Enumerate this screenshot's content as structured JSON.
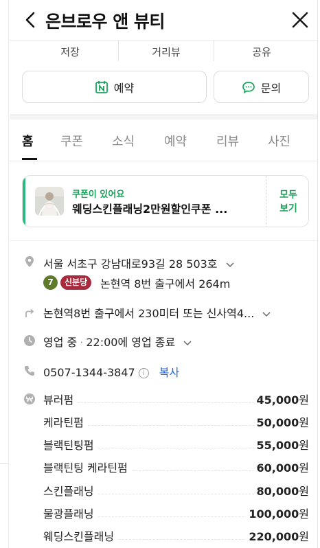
{
  "header": {
    "title": "은브로우 앤 뷰티"
  },
  "top_actions": [
    "저장",
    "거리뷰",
    "공유"
  ],
  "buttons": {
    "reserve": "예약",
    "inquiry": "문의"
  },
  "tabs": [
    "홈",
    "쿠폰",
    "소식",
    "예약",
    "리뷰",
    "사진"
  ],
  "coupon": {
    "subtitle": "쿠폰이 있어요",
    "title": "웨딩스킨플래닝2만원할인쿠폰 ...",
    "more_line1": "모두",
    "more_line2": "보기"
  },
  "info": {
    "address": "서울 서초구 강남대로93길 28 503호",
    "subway_line_number": "7",
    "subway_line_name": "신분당",
    "subway_direction": "논현역 8번 출구에서 264m",
    "route": "논현역8번 출구에서 230미터 또는 신사역4...",
    "status": "영업 중",
    "hours": "22:00에 영업 종료",
    "phone": "0507-1344-3847",
    "copy": "복사"
  },
  "prices": [
    {
      "name": "뷰러펌",
      "amount": "45,000",
      "unit": "원"
    },
    {
      "name": "케라틴펌",
      "amount": "50,000",
      "unit": "원"
    },
    {
      "name": "블랙틴팅펌",
      "amount": "55,000",
      "unit": "원"
    },
    {
      "name": "블랙틴팅 케라틴펌",
      "amount": "60,000",
      "unit": "원"
    },
    {
      "name": "스킨플래닝",
      "amount": "80,000",
      "unit": "원"
    },
    {
      "name": "물광플래닝",
      "amount": "100,000",
      "unit": "원"
    },
    {
      "name": "웨딩스킨플래닝",
      "amount": "220,000",
      "unit": "원"
    }
  ],
  "colors": {
    "accent_green": "#17a35a",
    "line7": "#5e7a2a",
    "sinbundang": "#a82a3c",
    "link_blue": "#1f66d1"
  }
}
